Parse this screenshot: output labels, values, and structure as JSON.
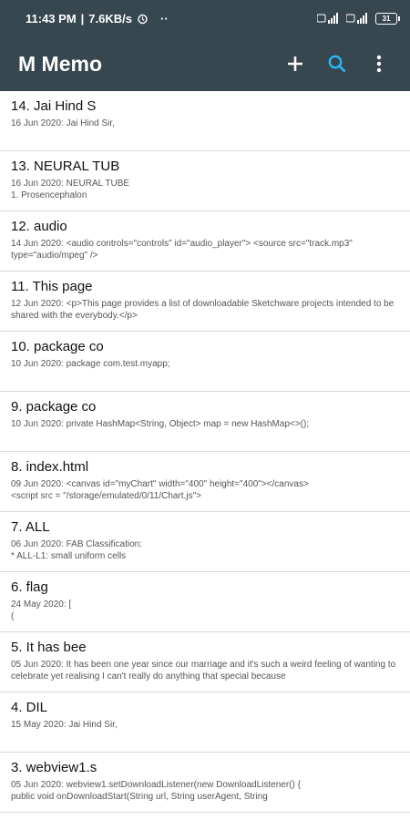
{
  "status": {
    "time": "11:43 PM",
    "speed": "7.6KB/s",
    "battery": "31",
    "sim1": "Vo LTE",
    "sim2": "Vo LTE"
  },
  "appbar": {
    "title": "M Memo",
    "icons": [
      "add-icon",
      "search-icon",
      "more-vert-icon"
    ],
    "accent": "#29b6f6",
    "background": "#37474f"
  },
  "notes": [
    {
      "title": "14. Jai Hind S",
      "preview": "16 Jun 2020: Jai Hind Sir,"
    },
    {
      "title": "13. NEURAL TUB",
      "preview": "16 Jun 2020: NEURAL TUBE\n1. Prosencephalon"
    },
    {
      "title": "12. audio",
      "preview": "14 Jun 2020: <audio controls=\"controls\" id=\"audio_player\"> <source src=\"track.mp3\" type=\"audio/mpeg\" />"
    },
    {
      "title": "11. This page",
      "preview": "12 Jun 2020: <p>This page provides a list of downloadable Sketchware projects intended to be shared with the everybody.</p>"
    },
    {
      "title": "10. package co",
      "preview": "10 Jun 2020: package com.test.myapp;"
    },
    {
      "title": "9. package co",
      "preview": "10 Jun 2020: private HashMap<String, Object> map = new HashMap<>();"
    },
    {
      "title": "8. index.html",
      "preview": "09 Jun 2020: <canvas id=\"myChart\" width=\"400\" height=\"400\"></canvas>\n<script src = \"/storage/emulated/0/11/Chart.js\">"
    },
    {
      "title": "7. ALL",
      "preview": "06 Jun 2020: FAB Classification:\n* ALL-L1: small uniform cells"
    },
    {
      "title": "6. flag",
      "preview": "24 May 2020: [\n("
    },
    {
      "title": "5. It has bee",
      "preview": "05 Jun 2020: It has been one year since our marriage and it's such a weird feeling of wanting to celebrate yet realising I can't really do anything that special because"
    },
    {
      "title": "4. DIL",
      "preview": "15 May 2020: Jai Hind Sir,"
    },
    {
      "title": "3. webview1.s",
      "preview": "05 Jun 2020: webview1.setDownloadListener(new DownloadListener() {\npublic void onDownloadStart(String url, String userAgent, String"
    }
  ]
}
